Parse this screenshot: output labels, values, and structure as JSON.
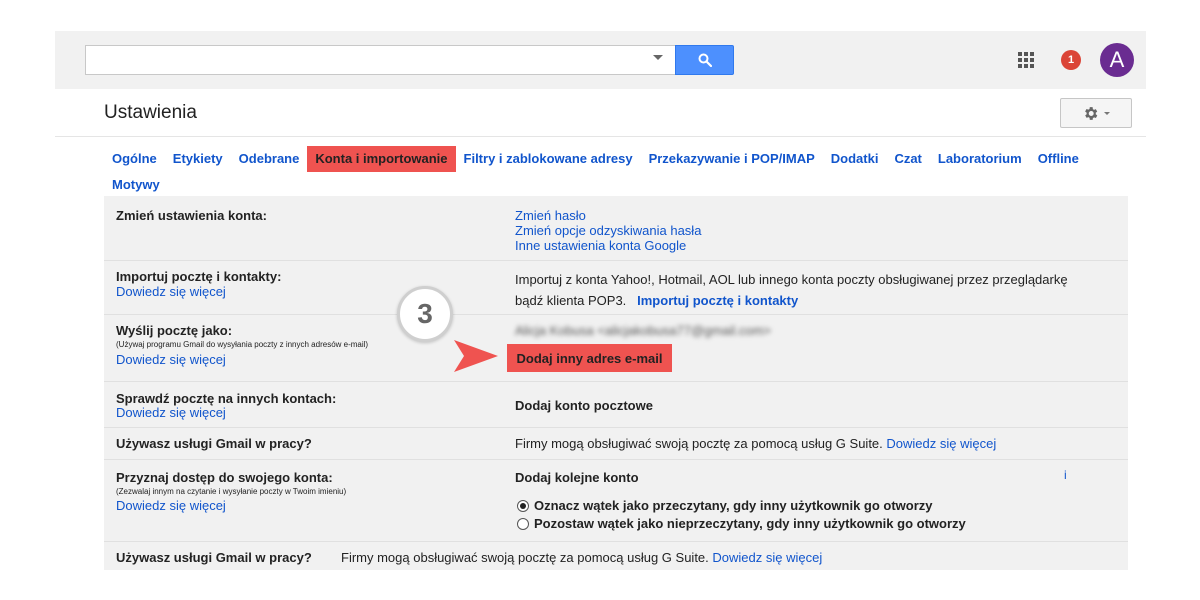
{
  "search": {
    "placeholder": "",
    "value": ""
  },
  "header": {
    "notification_count": "1",
    "avatar_letter": "A"
  },
  "page": {
    "title": "Ustawienia"
  },
  "tabs": [
    {
      "label": "Ogólne",
      "active": false
    },
    {
      "label": "Etykiety",
      "active": false
    },
    {
      "label": "Odebrane",
      "active": false
    },
    {
      "label": "Konta i importowanie",
      "active": true
    },
    {
      "label": "Filtry i zablokowane adresy",
      "active": false
    },
    {
      "label": "Przekazywanie i POP/IMAP",
      "active": false
    },
    {
      "label": "Dodatki",
      "active": false
    },
    {
      "label": "Czat",
      "active": false
    },
    {
      "label": "Laboratorium",
      "active": false
    },
    {
      "label": "Offline",
      "active": false
    },
    {
      "label": "Motywy",
      "active": false
    }
  ],
  "settings": {
    "change_account": {
      "label": "Zmień ustawienia konta:",
      "links": [
        "Zmień hasło",
        "Zmień opcje odzyskiwania hasła",
        "Inne ustawienia konta Google"
      ]
    },
    "import": {
      "label": "Importuj pocztę i kontakty:",
      "learn_more": "Dowiedz się więcej",
      "text_line1": "Importuj z konta Yahoo!, Hotmail, AOL lub innego konta poczty obsługiwanej przez przeglądarkę",
      "text_line2": "bądź klienta POP3.",
      "action": "Importuj pocztę i kontakty"
    },
    "send_as": {
      "label": "Wyślij pocztę jako:",
      "sub": "(Używaj programu Gmail do wysyłania poczty z innych adresów e-mail)",
      "learn_more": "Dowiedz się więcej",
      "blurred_address": "Alicja Kobusa <alicjakobusa77@gmail.com>",
      "add_button": "Dodaj inny adres e-mail"
    },
    "check_mail": {
      "label": "Sprawdź pocztę na innych kontach:",
      "learn_more": "Dowiedz się więcej",
      "action": "Dodaj konto pocztowe"
    },
    "work": {
      "label": "Używasz usługi Gmail w pracy?",
      "text": "Firmy mogą obsługiwać swoją pocztę za pomocą usług G Suite.",
      "learn_more": "Dowiedz się więcej"
    },
    "grant_access": {
      "label": "Przyznaj dostęp do swojego konta:",
      "sub": "(Zezwalaj innym na czytanie i wysyłanie poczty w Twoim imieniu)",
      "learn_more": "Dowiedz się więcej",
      "action": "Dodaj kolejne konto",
      "option1": "Oznacz wątek jako przeczytany, gdy inny użytkownik go otworzy",
      "option2": "Pozostaw wątek jako nieprzeczytany, gdy inny użytkownik go otworzy",
      "stray": "i"
    },
    "work2": {
      "label": "Używasz usługi Gmail w pracy?",
      "text": "Firmy mogą obsługiwać swoją pocztę za pomocą usług G Suite.",
      "learn_more": "Dowiedz się więcej"
    }
  },
  "callout": {
    "step": "3"
  },
  "colors": {
    "highlight": "#ef5350",
    "link": "#1155cc",
    "search_button": "#4d90fe",
    "avatar": "#6a2c91",
    "notification": "#db4437"
  }
}
